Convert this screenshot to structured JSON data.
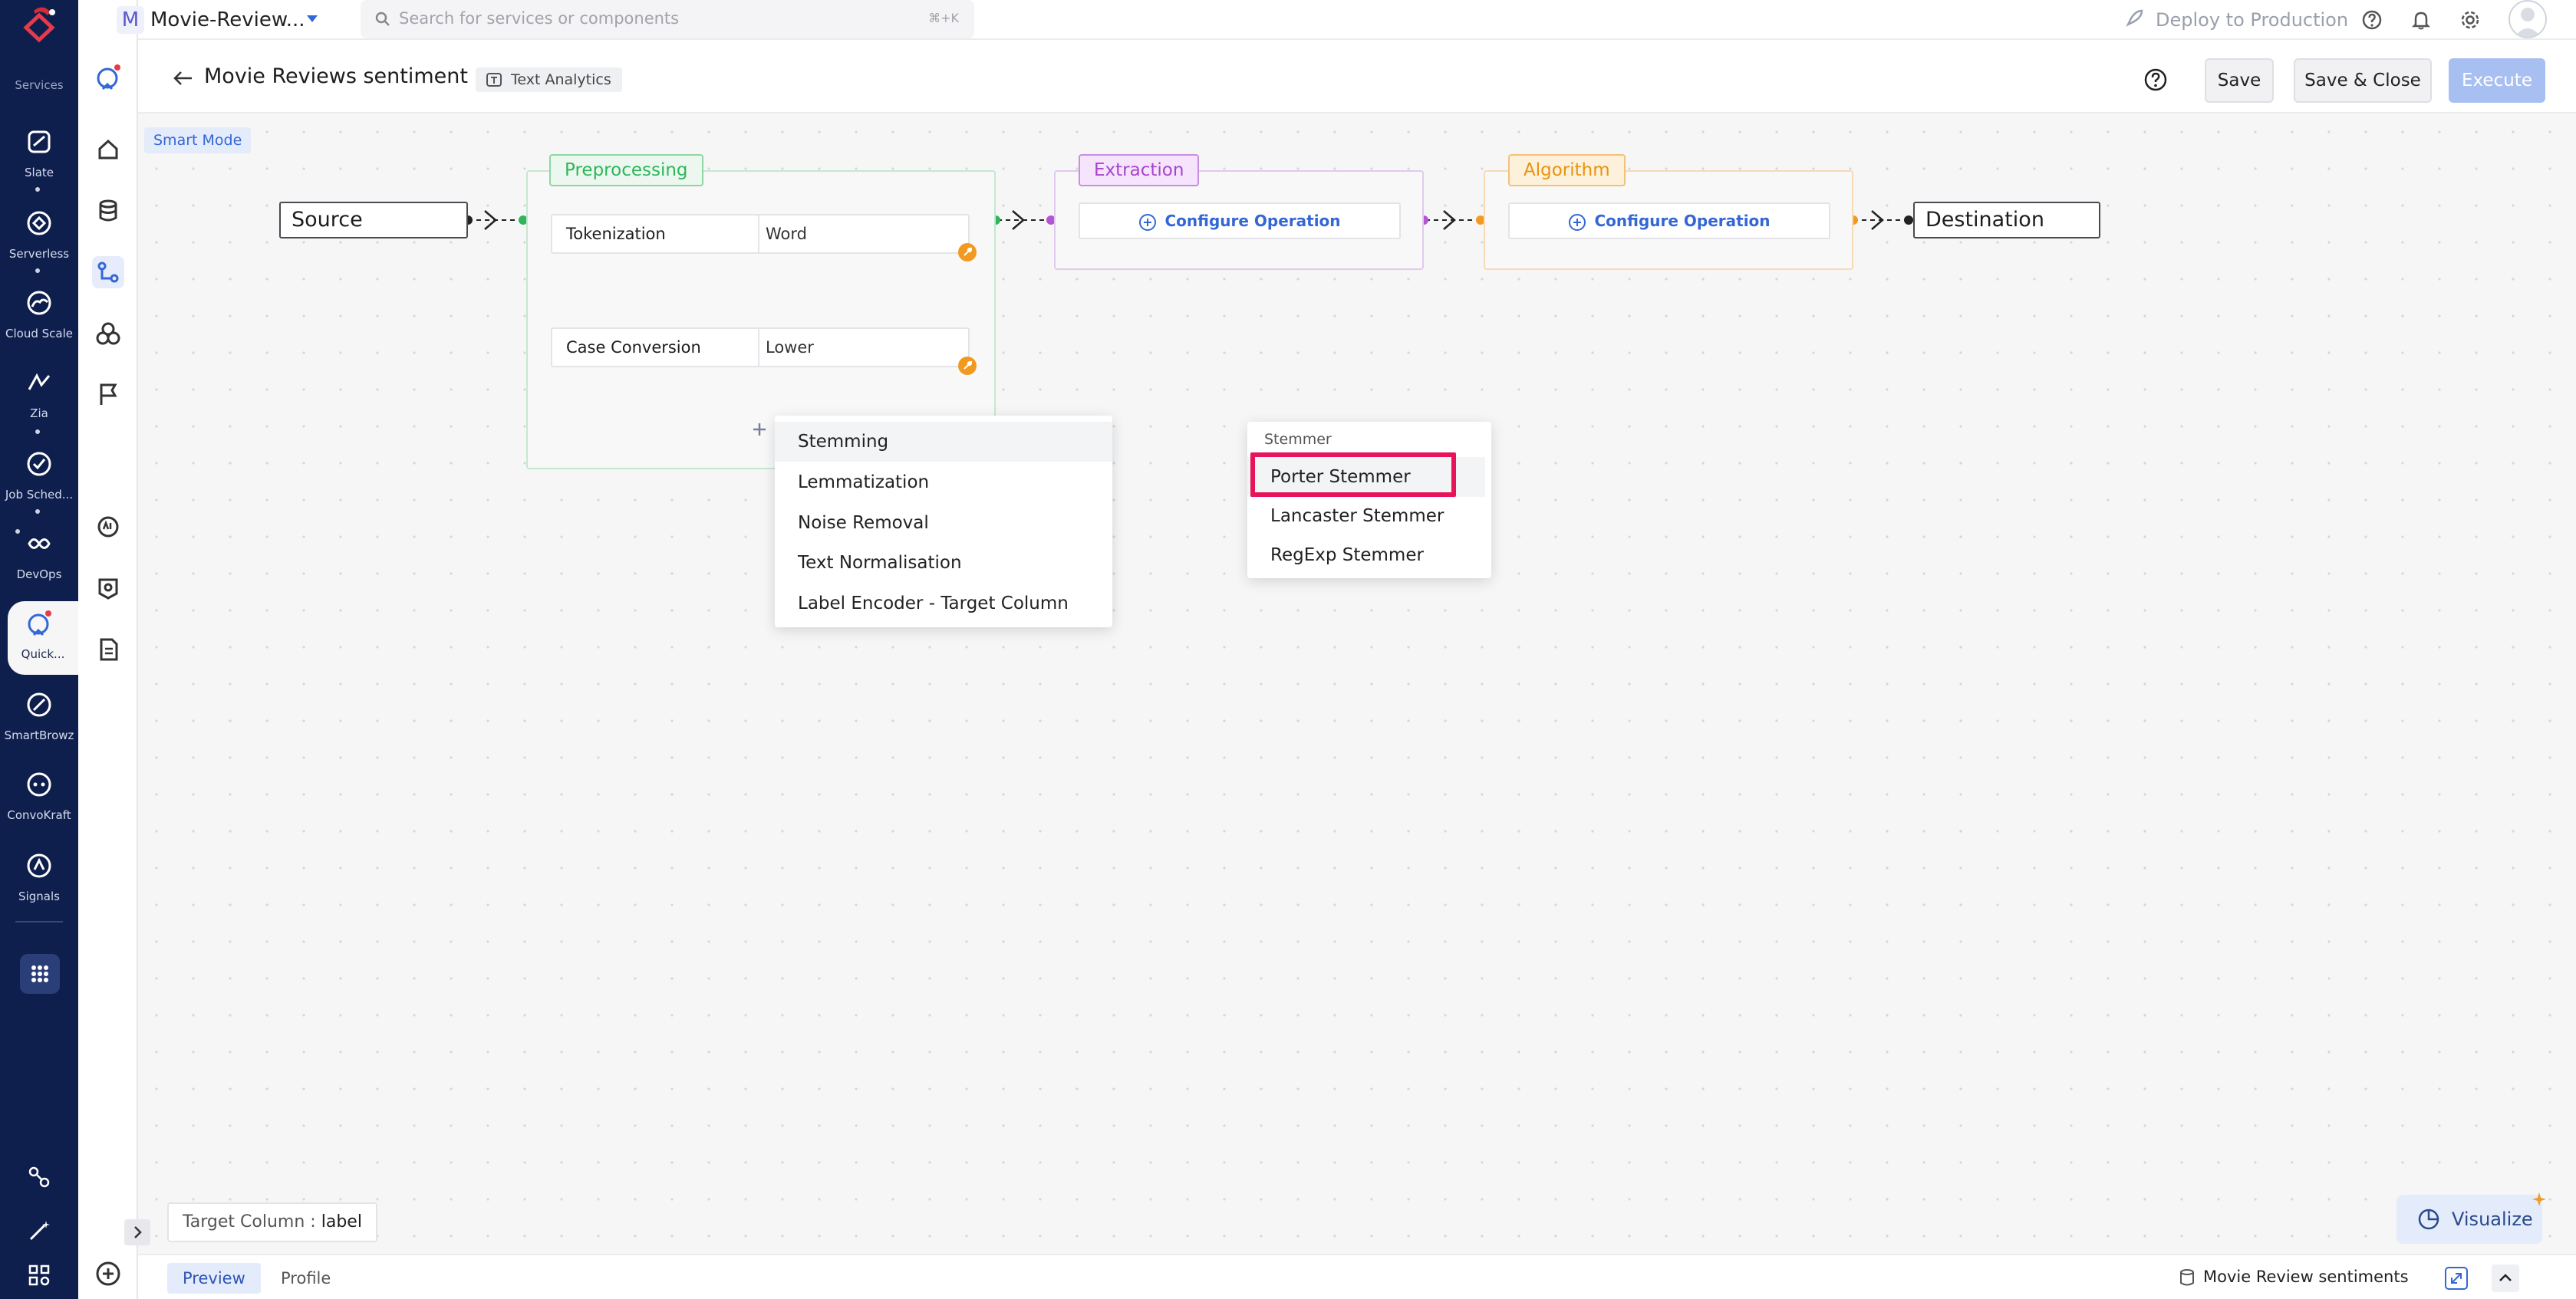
{
  "services_heading": "Services",
  "rail_items": [
    {
      "label": "Slate",
      "icon": "slate-icon"
    },
    {
      "label": "Serverless",
      "icon": "serverless-icon"
    },
    {
      "label": "Cloud Scale",
      "icon": "cloud-scale-icon"
    },
    {
      "label": "Zia",
      "icon": "zia-icon"
    },
    {
      "label": "Job Sched...",
      "icon": "job-scheduling-icon"
    },
    {
      "label": "DevOps",
      "icon": "devops-icon"
    },
    {
      "label": "Quick...",
      "icon": "quickml-icon"
    },
    {
      "label": "SmartBrowz",
      "icon": "smartbrowz-icon"
    },
    {
      "label": "ConvoKraft",
      "icon": "convokraft-icon"
    },
    {
      "label": "Signals",
      "icon": "signals-icon"
    }
  ],
  "topbar": {
    "project_initial": "M",
    "project_name": "Movie-Review...",
    "search_placeholder": "Search for services or components",
    "search_shortcut": "⌘+K",
    "deploy_label": "Deploy to Production"
  },
  "header": {
    "title": "Movie Reviews sentiment",
    "chip": "Text Analytics",
    "save": "Save",
    "save_close": "Save & Close",
    "execute": "Execute"
  },
  "canvas": {
    "smart_mode": "Smart Mode",
    "source": "Source",
    "destination": "Destination",
    "preprocessing": {
      "tag": "Preprocessing",
      "ops": [
        {
          "name": "Tokenization",
          "value": "Word"
        },
        {
          "name": "Case Conversion",
          "value": "Lower"
        }
      ]
    },
    "extraction": {
      "tag": "Extraction",
      "configure": "Configure Operation"
    },
    "algorithm": {
      "tag": "Algorithm",
      "configure": "Configure Operation"
    },
    "op_menu": [
      "Stemming",
      "Lemmatization",
      "Noise Removal",
      "Text Normalisation",
      "Label Encoder - Target Column"
    ],
    "submenu": {
      "heading": "Stemmer",
      "items": [
        "Porter Stemmer",
        "Lancaster Stemmer",
        "RegExp Stemmer"
      ]
    },
    "target_column": {
      "label": "Target Column :",
      "value": "label"
    },
    "visualize": "Visualize"
  },
  "footer": {
    "tabs": [
      "Preview",
      "Profile"
    ],
    "dataset": "Movie Review sentiments"
  },
  "colors": {
    "rail_bg": "#0f1f4d",
    "accent": "#3467d6",
    "preprocessing": "#2fb55a",
    "extraction": "#b455d6",
    "algorithm": "#f29a1f",
    "highlight": "#e8145a"
  }
}
